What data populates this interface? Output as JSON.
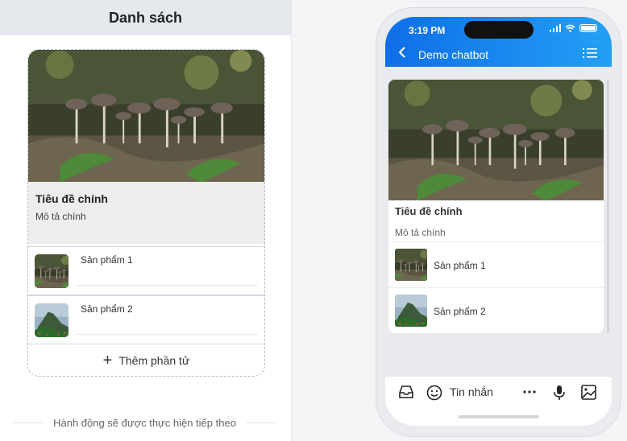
{
  "editor": {
    "header_title": "Danh sách",
    "card": {
      "title": "Tiêu đề chính",
      "description": "Mô tả chính"
    },
    "items": [
      {
        "label": "Sản phẩm 1"
      },
      {
        "label": "Sản phẩm 2"
      }
    ],
    "add_button_label": "Thêm phần tử",
    "footer_note": "Hành động sẽ được thực hiện tiếp theo"
  },
  "phone": {
    "status_time": "3:19 PM",
    "bot_name": "Demo chatbot",
    "header_color": "#1a86ee",
    "card": {
      "title": "Tiêu đề chính",
      "description": "Mô tả chính"
    },
    "items": [
      {
        "label": "Sản phẩm 1"
      },
      {
        "label": "Sản phẩm 2"
      }
    ],
    "input_placeholder": "Tin nhắn",
    "icons": [
      "back-icon",
      "menu-list-icon",
      "inbox-icon",
      "emoji-icon",
      "more-icon",
      "mic-icon",
      "image-icon"
    ]
  }
}
